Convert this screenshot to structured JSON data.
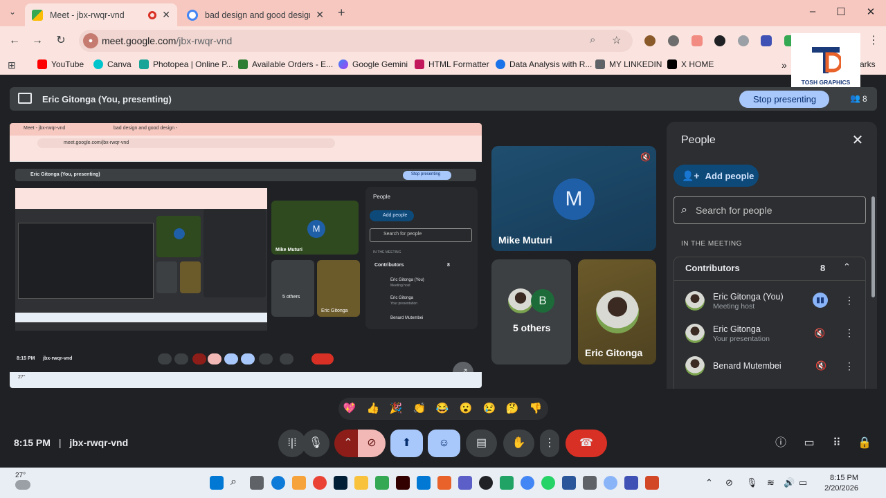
{
  "browser": {
    "tabs": [
      {
        "title": "Meet - jbx-rwqr-vnd",
        "active": true
      },
      {
        "title": "bad design and good design - ",
        "active": false
      }
    ],
    "new_tab": "+",
    "window_controls": [
      "–",
      "☐",
      "✕"
    ],
    "url_host": "meet.google.com",
    "url_path": "/jbx-rwqr-vnd",
    "bookmarks": [
      "YouTube",
      "Canva",
      "Photopea | Online P...",
      "Available Orders - E...",
      "Google Gemini",
      "HTML Formatter",
      "Data Analysis with R...",
      "MY LINKEDIN",
      "X HOME"
    ],
    "bookmarks_overflow": "»",
    "all_bookmarks": "arks"
  },
  "logo": {
    "text": "TOSH GRAPHICS"
  },
  "meet": {
    "presenting_text": "Eric Gitonga (You, presenting)",
    "stop_presenting": "Stop presenting",
    "participant_count": "8",
    "tiles": {
      "mike": {
        "initial": "M",
        "name": "Mike Muturi"
      },
      "others": {
        "initial": "B",
        "label": "5 others"
      },
      "eric": {
        "name": "Eric Gitonga"
      }
    },
    "people_panel": {
      "title": "People",
      "add_people": "Add people",
      "search_placeholder": "Search for people",
      "section": "IN THE MEETING",
      "group_label": "Contributors",
      "group_count": "8",
      "participants": [
        {
          "name": "Eric Gitonga (You)",
          "role": "Meeting host"
        },
        {
          "name": "Eric Gitonga",
          "role": "Your presentation"
        },
        {
          "name": "Benard Mutembei",
          "role": ""
        }
      ]
    },
    "reactions": [
      "💖",
      "👍",
      "🎉",
      "👏",
      "😂",
      "😮",
      "😢",
      "🤔",
      "👎"
    ],
    "time": "8:15 PM",
    "separator": "|",
    "meeting_code": "jbx-rwqr-vnd",
    "controls": [
      "audio-levels",
      "mic",
      "more-options",
      "camera-off",
      "present",
      "emoji",
      "captions",
      "raise-hand",
      "more",
      "leave-call"
    ],
    "right_controls": [
      "info",
      "chat",
      "activities",
      "host-controls"
    ]
  },
  "shared_screen": {
    "tab1": "Meet - jbx-rwqr-vnd",
    "tab2": "bad design and good design -",
    "url": "meet.google.com/jbx-rwqr-vnd",
    "presenting_text": "Eric Gitonga (You, presenting)",
    "stop_presenting": "Stop presenting",
    "people_title": "People",
    "add_people": "Add people",
    "search_placeholder": "Search for people",
    "section": "IN THE MEETING",
    "group_label": "Contributors",
    "group_count": "8",
    "p1": "Eric Gitonga (You)",
    "p1_role": "Meeting host",
    "p2": "Eric Gitonga",
    "p2_role": "Your presentation",
    "p3": "Benard Mutembei",
    "tile_mike": "Mike Muturi",
    "tile_initial": "M",
    "tile_others": "5 others",
    "tile_eric": "Eric Gitonga",
    "time": "8:15 PM",
    "code": "jbx-rwqr-vnd",
    "weather": "27°"
  },
  "taskbar": {
    "weather": "27°",
    "time": "8:15 PM",
    "date": "2/20/2026"
  }
}
